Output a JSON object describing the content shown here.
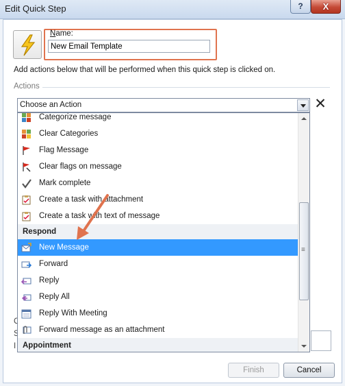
{
  "window": {
    "title": "Edit Quick Step",
    "help_label": "?",
    "close_label": "X"
  },
  "name": {
    "label": "Name:",
    "value": "New Email Template"
  },
  "description": "Add actions below that will be performed when this quick step is clicked on.",
  "actions": {
    "group_label": "Actions",
    "combo_value": "Choose an Action",
    "remove_label": "✕"
  },
  "dropdown": {
    "items": [
      {
        "type": "item",
        "label": "Categorize message",
        "icon": "categorize-icon"
      },
      {
        "type": "item",
        "label": "Clear Categories",
        "icon": "clear-categories-icon"
      },
      {
        "type": "item",
        "label": "Flag Message",
        "icon": "flag-icon"
      },
      {
        "type": "item",
        "label": "Clear flags on message",
        "icon": "clear-flag-icon"
      },
      {
        "type": "item",
        "label": "Mark complete",
        "icon": "checkmark-icon"
      },
      {
        "type": "item",
        "label": "Create a task with attachment",
        "icon": "task-icon"
      },
      {
        "type": "item",
        "label": "Create a task with text of message",
        "icon": "task-icon"
      },
      {
        "type": "header",
        "label": "Respond"
      },
      {
        "type": "item",
        "label": "New Message",
        "icon": "new-message-icon",
        "selected": true
      },
      {
        "type": "item",
        "label": "Forward",
        "icon": "forward-icon"
      },
      {
        "type": "item",
        "label": "Reply",
        "icon": "reply-icon"
      },
      {
        "type": "item",
        "label": "Reply All",
        "icon": "reply-all-icon"
      },
      {
        "type": "item",
        "label": "Reply With Meeting",
        "icon": "meeting-icon"
      },
      {
        "type": "item",
        "label": "Forward message as an attachment",
        "icon": "attachment-icon"
      },
      {
        "type": "header",
        "label": "Appointment"
      }
    ]
  },
  "behind": {
    "label_fragments": [
      "C",
      "S",
      "I"
    ]
  },
  "buttons": {
    "finish": "Finish",
    "cancel": "Cancel"
  },
  "colors": {
    "selection": "#3399ff",
    "annotation_arrow": "#e0734e"
  }
}
